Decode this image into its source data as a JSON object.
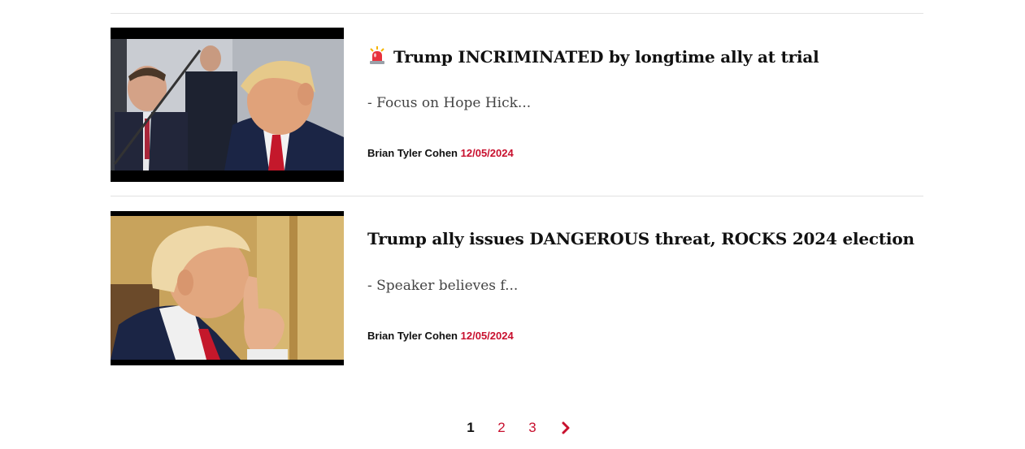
{
  "articles": [
    {
      "title": "Trump INCRIMINATED by longtime ally at trial",
      "excerpt": "- Focus on Hope Hick...",
      "author": "Brian Tyler Cohen",
      "date": "12/05/2024",
      "has_alert_icon": true
    },
    {
      "title": "Trump ally issues DANGEROUS threat, ROCKS 2024 election",
      "excerpt": "- Speaker believes f...",
      "author": "Brian Tyler Cohen",
      "date": "12/05/2024",
      "has_alert_icon": false
    }
  ],
  "pagination": {
    "current": "1",
    "pages": [
      "2",
      "3"
    ],
    "next_icon": "chevron-right-icon"
  },
  "colors": {
    "accent": "#c8102e",
    "text": "#111111",
    "excerpt": "#444444",
    "divider": "#e2e2e2"
  }
}
